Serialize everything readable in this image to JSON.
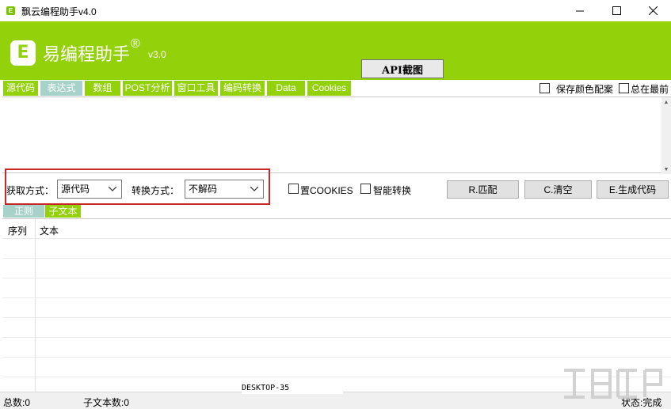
{
  "window": {
    "title": "飘云编程助手v4.0",
    "app_icon_letter": "E",
    "minimize_icon": "minimize-icon",
    "maximize_icon": "maximize-icon",
    "close_icon": "close-icon"
  },
  "header": {
    "logo_letter": "E",
    "brand": "易编程助手",
    "registered": "®",
    "version": "v3.0",
    "api_button": "API截图",
    "bg_color": "#93d10b"
  },
  "tabs": [
    {
      "label": "源代码",
      "active": false
    },
    {
      "label": "表达式",
      "active": true
    },
    {
      "label": "数组",
      "active": false
    },
    {
      "label": "POST分析",
      "active": false
    },
    {
      "label": "窗口工具",
      "active": false
    },
    {
      "label": "编码转换",
      "active": false
    },
    {
      "label": "Data",
      "active": false
    },
    {
      "label": "Cookies",
      "active": false
    }
  ],
  "options": {
    "save_colors": "保存颜色配案",
    "always_on_top": "总在最前"
  },
  "controls": {
    "fetch_label": "获取方式：",
    "fetch_value": "源代码",
    "convert_label": "转换方式：",
    "convert_value": "不解码",
    "cookies_check": "置COOKIES",
    "smart_check": "智能转换",
    "match_button": "R.匹配",
    "clear_button": "C.清空",
    "generate_button": "E.生成代码",
    "highlight_color": "#c82828"
  },
  "subtabs": {
    "regex": "正则",
    "subtext": "子文本"
  },
  "table": {
    "columns": [
      "序列",
      "文本"
    ]
  },
  "status": {
    "total": "总数:0",
    "subtext_count": "子文本数:0",
    "desktop": "DESKTOP-35",
    "state": "状态:完成"
  }
}
